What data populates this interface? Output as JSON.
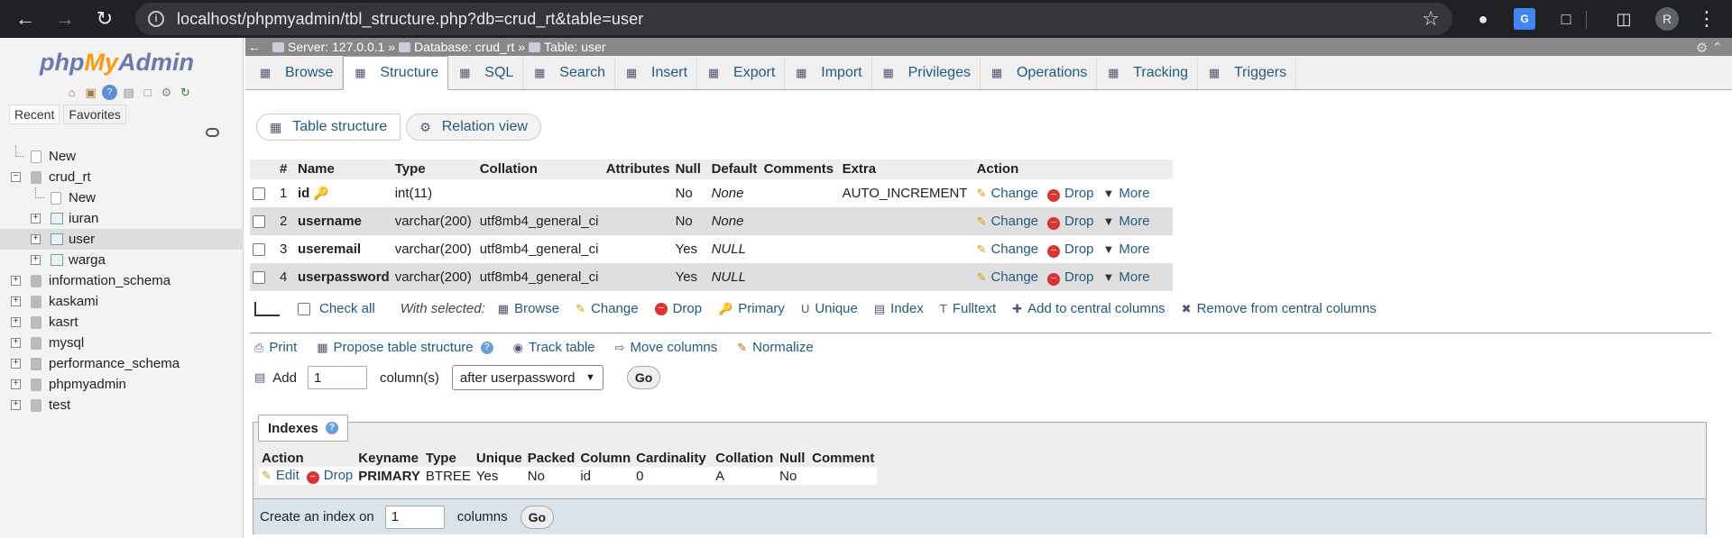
{
  "browser": {
    "url": "localhost/phpmyadmin/tbl_structure.php?db=crud_rt&table=user",
    "avatar_letter": "R"
  },
  "logo": {
    "php": "php",
    "my": "My",
    "admin": "Admin"
  },
  "nav": {
    "tabs": [
      "Recent",
      "Favorites"
    ],
    "tree": [
      {
        "label": "New",
        "level": 0,
        "kind": "new"
      },
      {
        "label": "crud_rt",
        "level": 0,
        "kind": "db",
        "expanded": true
      },
      {
        "label": "New",
        "level": 1,
        "kind": "new"
      },
      {
        "label": "iuran",
        "level": 1,
        "kind": "table"
      },
      {
        "label": "user",
        "level": 1,
        "kind": "table",
        "selected": true
      },
      {
        "label": "warga",
        "level": 1,
        "kind": "table"
      },
      {
        "label": "information_schema",
        "level": 0,
        "kind": "db"
      },
      {
        "label": "kaskami",
        "level": 0,
        "kind": "db"
      },
      {
        "label": "kasrt",
        "level": 0,
        "kind": "db"
      },
      {
        "label": "mysql",
        "level": 0,
        "kind": "db"
      },
      {
        "label": "performance_schema",
        "level": 0,
        "kind": "db"
      },
      {
        "label": "phpmyadmin",
        "level": 0,
        "kind": "db"
      },
      {
        "label": "test",
        "level": 0,
        "kind": "db"
      }
    ]
  },
  "breadcrumb": {
    "server": "Server: 127.0.0.1 »",
    "database": "Database: crud_rt »",
    "table": "Table: user"
  },
  "tabs": [
    {
      "label": "Browse",
      "icon": "browse-icon"
    },
    {
      "label": "Structure",
      "icon": "structure-icon",
      "active": true
    },
    {
      "label": "SQL",
      "icon": "sql-icon"
    },
    {
      "label": "Search",
      "icon": "search-icon"
    },
    {
      "label": "Insert",
      "icon": "insert-icon"
    },
    {
      "label": "Export",
      "icon": "export-icon"
    },
    {
      "label": "Import",
      "icon": "import-icon"
    },
    {
      "label": "Privileges",
      "icon": "privileges-icon"
    },
    {
      "label": "Operations",
      "icon": "operations-icon"
    },
    {
      "label": "Tracking",
      "icon": "tracking-icon"
    },
    {
      "label": "Triggers",
      "icon": "triggers-icon"
    }
  ],
  "subtabs": {
    "structure": "Table structure",
    "relation": "Relation view"
  },
  "structure": {
    "headers": [
      "#",
      "Name",
      "Type",
      "Collation",
      "Attributes",
      "Null",
      "Default",
      "Comments",
      "Extra",
      "Action"
    ],
    "rows": [
      {
        "num": "1",
        "name": "id",
        "primary": true,
        "type": "int(11)",
        "collation": "",
        "attributes": "",
        "null": "No",
        "default": "None",
        "comments": "",
        "extra": "AUTO_INCREMENT"
      },
      {
        "num": "2",
        "name": "username",
        "primary": false,
        "type": "varchar(200)",
        "collation": "utf8mb4_general_ci",
        "attributes": "",
        "null": "No",
        "default": "None",
        "comments": "",
        "extra": ""
      },
      {
        "num": "3",
        "name": "useremail",
        "primary": false,
        "type": "varchar(200)",
        "collation": "utf8mb4_general_ci",
        "attributes": "",
        "null": "Yes",
        "default": "NULL",
        "comments": "",
        "extra": ""
      },
      {
        "num": "4",
        "name": "userpassword",
        "primary": false,
        "type": "varchar(200)",
        "collation": "utf8mb4_general_ci",
        "attributes": "",
        "null": "Yes",
        "default": "NULL",
        "comments": "",
        "extra": ""
      }
    ],
    "actions": {
      "change": "Change",
      "drop": "Drop",
      "more": "More"
    }
  },
  "with_selected": {
    "check_all": "Check all",
    "label": "With selected:",
    "actions": [
      "Browse",
      "Change",
      "Drop",
      "Primary",
      "Unique",
      "Index",
      "Fulltext",
      "Add to central columns",
      "Remove from central columns"
    ]
  },
  "ops": {
    "print": "Print",
    "propose": "Propose table structure",
    "track": "Track table",
    "move": "Move columns",
    "normalize": "Normalize"
  },
  "add_columns": {
    "label": "Add",
    "value": "1",
    "unit": "column(s)",
    "position": "after userpassword",
    "go": "Go"
  },
  "indexes": {
    "title": "Indexes",
    "headers": [
      "Action",
      "Keyname",
      "Type",
      "Unique",
      "Packed",
      "Column",
      "Cardinality",
      "Collation",
      "Null",
      "Comment"
    ],
    "rows": [
      {
        "edit": "Edit",
        "drop": "Drop",
        "keyname": "PRIMARY",
        "type": "BTREE",
        "unique": "Yes",
        "packed": "No",
        "column": "id",
        "cardinality": "0",
        "collation": "A",
        "null": "No",
        "comment": ""
      }
    ],
    "create_label": "Create an index on",
    "create_value": "1",
    "create_unit": "columns",
    "go": "Go"
  }
}
